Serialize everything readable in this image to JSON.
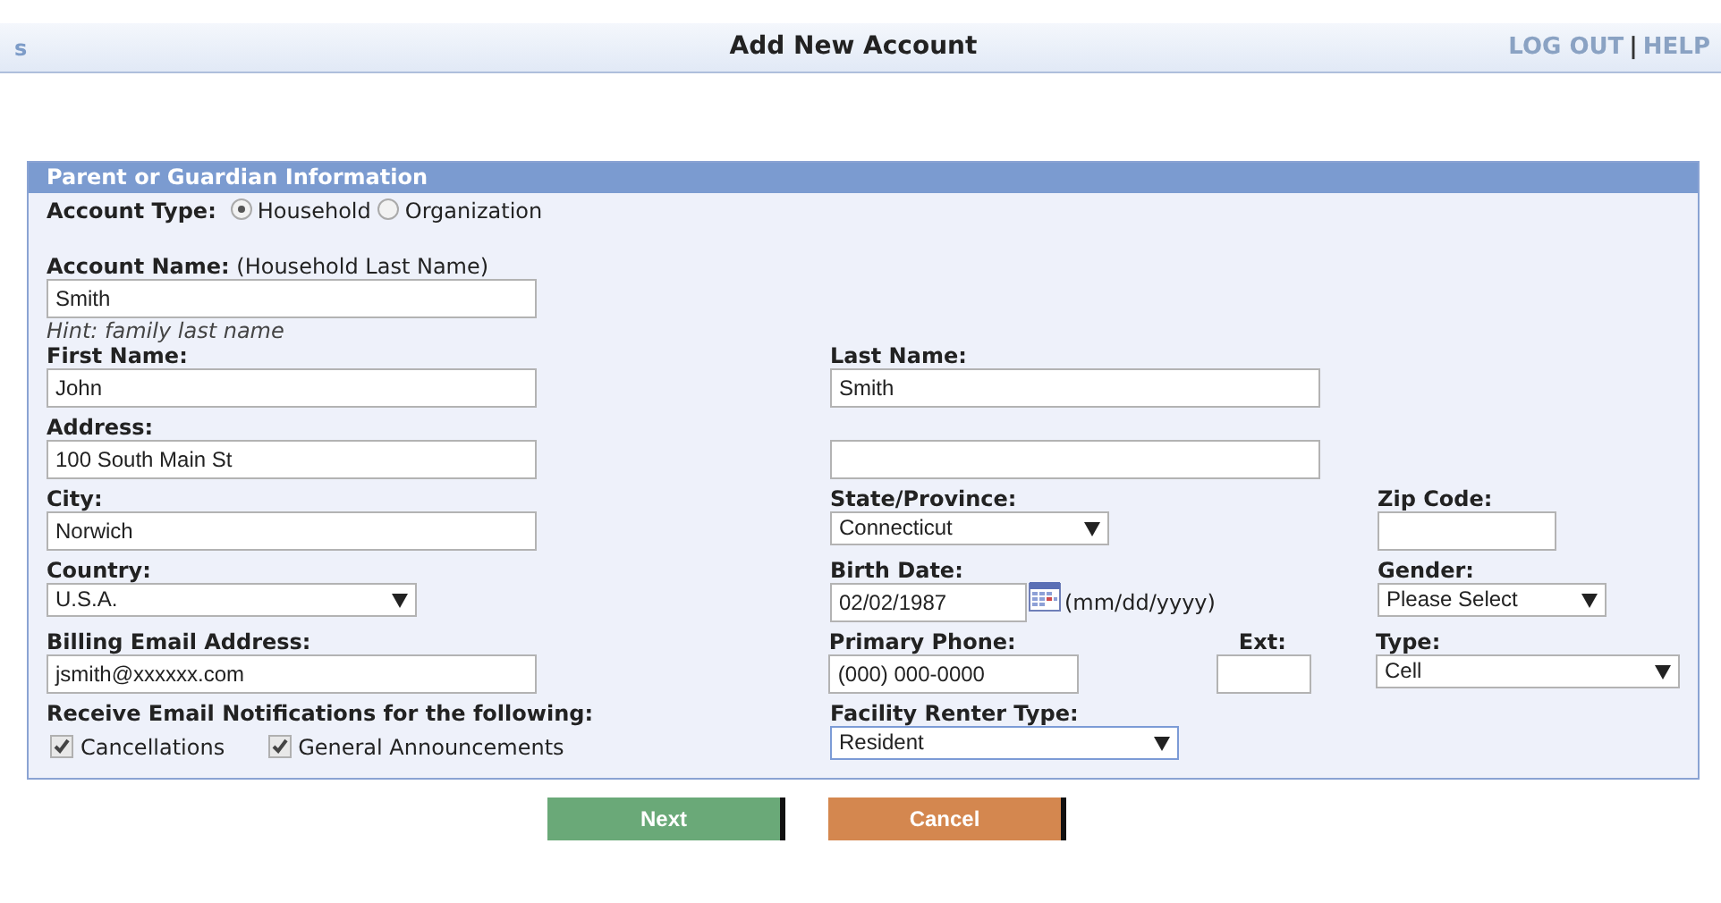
{
  "header": {
    "edge_text": "s",
    "title": "Add New Account",
    "links": [
      {
        "label": "LOG OUT"
      },
      {
        "label": "HELP"
      }
    ],
    "separator": "|"
  },
  "panel": {
    "title": "Parent or Guardian Information",
    "account_type": {
      "label": "Account Type:",
      "options": [
        {
          "label": "Household",
          "selected": true
        },
        {
          "label": "Organization",
          "selected": false
        }
      ]
    },
    "account_name": {
      "label": "Account Name:",
      "note": "(Household Last Name)",
      "value": "Smith",
      "hint": "Hint: family last name"
    },
    "rows": [
      {
        "left": {
          "kind": "text",
          "label": "First Name:",
          "value": "John"
        },
        "middle": {
          "kind": "text",
          "label": "Last Name:",
          "value": "Smith"
        }
      },
      {
        "left": {
          "kind": "text",
          "label": "Address:",
          "value": "100 South Main St"
        },
        "middle": {
          "kind": "text"
        }
      },
      {
        "left": {
          "kind": "text",
          "label": "City:",
          "value": "Norwich"
        },
        "middle": {
          "kind": "select",
          "label": "State/Province:",
          "value": "Connecticut"
        },
        "right": {
          "kind": "text",
          "label": "Zip Code:"
        }
      },
      {
        "left": {
          "kind": "select",
          "label": "Country:",
          "value": "U.S.A."
        },
        "middle": {
          "kind": "date",
          "label": "Birth Date:",
          "value": "02/02/1987",
          "format": "(mm/dd/yyyy)"
        },
        "right": {
          "kind": "select",
          "label": "Gender:",
          "value": "Please Select"
        }
      },
      {
        "left": {
          "kind": "text",
          "label": "Billing Email Address:",
          "value": "jsmith@xxxxxx.com"
        },
        "middle": {
          "kind": "text",
          "label": "Primary Phone:",
          "value": "(000) 000-0000",
          "ext": {
            "label": "Ext:"
          }
        },
        "right": {
          "kind": "select",
          "label": "Type:",
          "value": "Cell"
        }
      },
      {
        "left": {
          "kind": "checks",
          "label": "Receive Email Notifications for the following:",
          "options": [
            {
              "label": "Cancellations",
              "checked": true
            },
            {
              "label": "General Announcements",
              "checked": true
            }
          ]
        },
        "middle": {
          "kind": "select",
          "label": "Facility Renter Type:",
          "value": "Resident",
          "focused": true
        }
      }
    ]
  },
  "buttons": [
    {
      "label": "Next",
      "kind": "next"
    },
    {
      "label": "Cancel",
      "kind": "cancel"
    }
  ]
}
